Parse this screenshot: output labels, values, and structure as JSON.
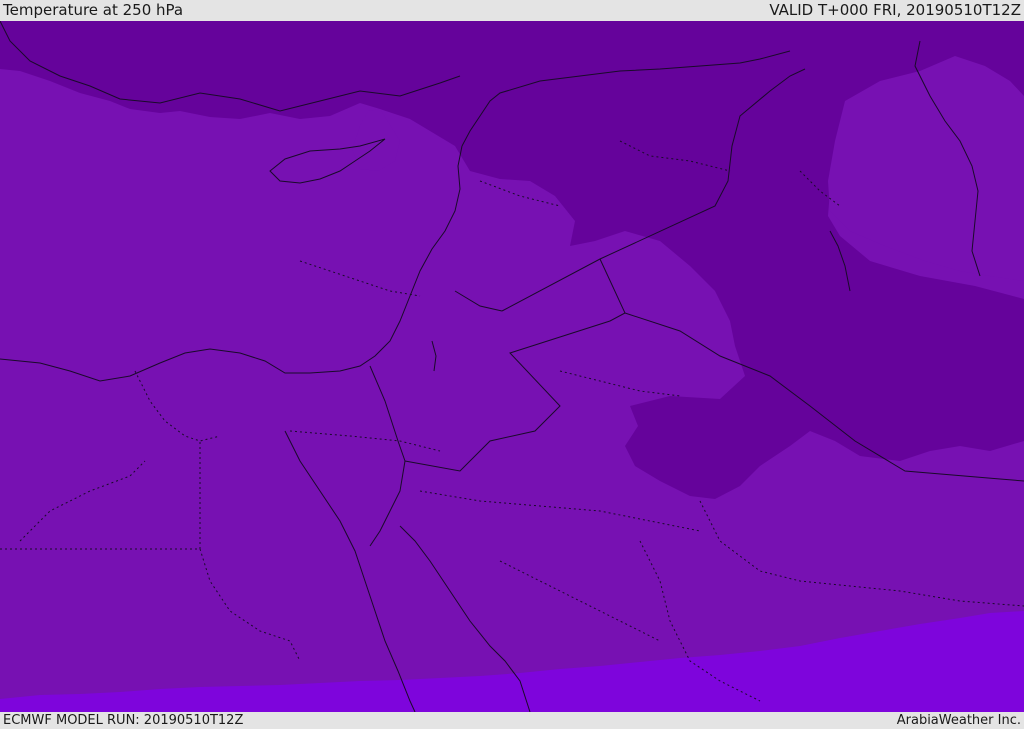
{
  "header": {
    "title": "Temperature at 250 hPa",
    "valid_time": "VALID T+000 FRI, 20190510T12Z"
  },
  "footer": {
    "model_run": "ECMWF MODEL RUN: 20190510T12Z",
    "credit": "ArabiaWeather Inc."
  },
  "map": {
    "colors": {
      "cold": "#65039b",
      "mid": "#7711b2",
      "warm": "#7e05dc",
      "coast": "#1a0a2a"
    },
    "icons": [
      "temperature-map",
      "coastline-layer",
      "border-layer"
    ]
  }
}
